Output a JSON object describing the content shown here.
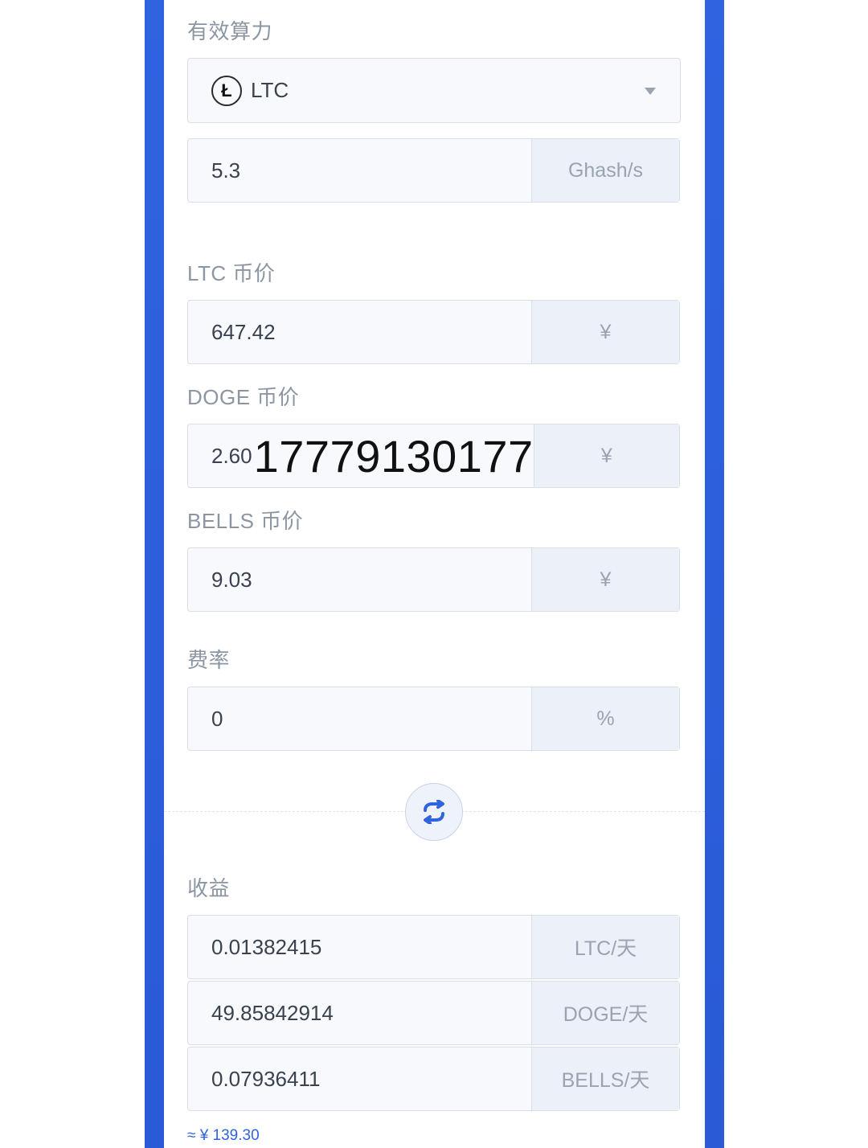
{
  "hashrate": {
    "label": "有效算力",
    "coin": {
      "name": "LTC",
      "icon_symbol": "Ł",
      "icon": "litecoin-icon"
    },
    "value": "5.3",
    "unit": "Ghash/s"
  },
  "prices": [
    {
      "label": "LTC 币价",
      "value": "647.42",
      "unit": "¥"
    },
    {
      "label": "DOGE 币价",
      "value": "2.60",
      "overlay": "17779130177",
      "unit": "¥"
    },
    {
      "label": "BELLS 币价",
      "value": "9.03",
      "unit": "¥"
    }
  ],
  "fee": {
    "label": "费率",
    "value": "0",
    "unit": "%"
  },
  "swap": {
    "icon": "swap-arrows-icon"
  },
  "earnings": {
    "label": "收益",
    "rows": [
      {
        "value": "0.01382415",
        "unit": "LTC/天"
      },
      {
        "value": "49.85842914",
        "unit": "DOGE/天"
      },
      {
        "value": "0.07936411",
        "unit": "BELLS/天"
      }
    ],
    "approx": "≈ ¥ 139.30"
  },
  "colors": {
    "accent": "#2f63e0",
    "border": "#d9dee7",
    "field_bg": "#f7f9fc",
    "unit_bg": "#ecf0f8"
  }
}
